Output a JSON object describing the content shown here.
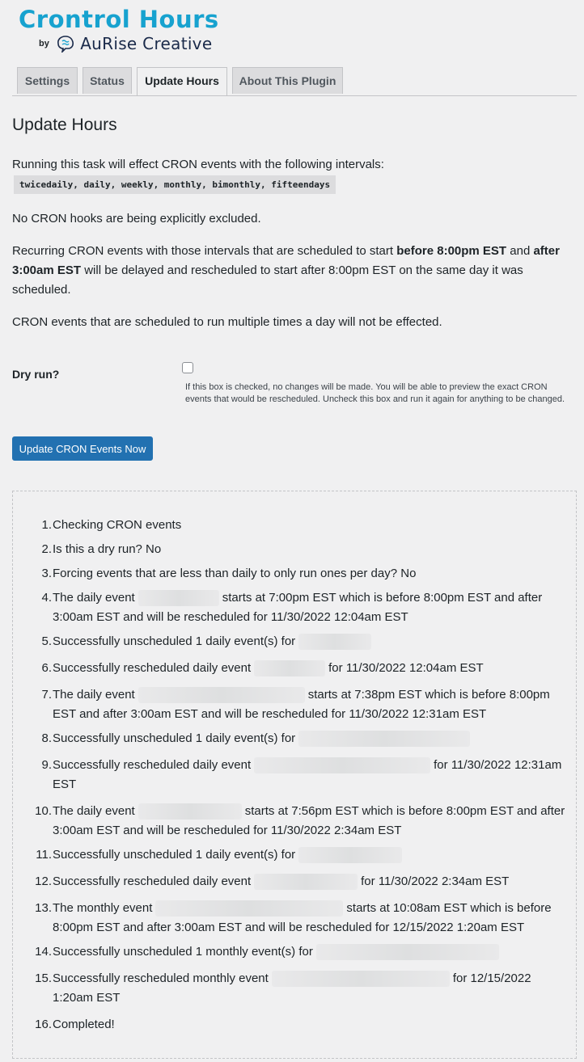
{
  "brand": {
    "title": "Crontrol Hours",
    "by": "by",
    "company": "AuRise Creative",
    "title_color": "#17a2cf"
  },
  "tabs": [
    {
      "label": "Settings",
      "active": false
    },
    {
      "label": "Status",
      "active": false
    },
    {
      "label": "Update Hours",
      "active": true
    },
    {
      "label": "About This Plugin",
      "active": false
    }
  ],
  "page": {
    "heading": "Update Hours",
    "intro": "Running this task will effect CRON events with the following intervals:",
    "intervals": "twicedaily, daily, weekly, monthly, bimonthly, fifteendays",
    "excluded": "No CRON hooks are being explicitly excluded.",
    "schedule": {
      "part1": "Recurring CRON events with those intervals that are scheduled to start ",
      "bold1": "before 8:00pm EST",
      "part2": " and ",
      "bold2": "after 3:00am EST",
      "part3": " will be delayed and rescheduled to start after 8:00pm EST on the same day it was scheduled."
    },
    "multiple": "CRON events that are scheduled to run multiple times a day will not be effected."
  },
  "form": {
    "dry_run_label": "Dry run?",
    "dry_run_checked": false,
    "dry_run_description": "If this box is checked, no changes will be made. You will be able to preview the exact CRON events that would be rescheduled. Uncheck this box and run it again for anything to be changed.",
    "submit_label": "Update CRON Events Now",
    "accent_color": "#2271b1"
  },
  "log": {
    "items": [
      {
        "num": "1.",
        "a": "Checking CRON events"
      },
      {
        "num": "2.",
        "a": "Is this a dry run? No"
      },
      {
        "num": "3.",
        "a": "Forcing events that are less than daily to only run ones per day? No"
      },
      {
        "num": "4.",
        "a": "The daily event",
        "b": "starts at 7:00pm EST which is before 8:00pm EST and after 3:00am EST and will be rescheduled for 11/30/2022 12:04am EST"
      },
      {
        "num": "5.",
        "a": "Successfully unscheduled 1 daily event(s) for"
      },
      {
        "num": "6.",
        "a": "Successfully rescheduled daily event",
        "b": "for 11/30/2022 12:04am EST"
      },
      {
        "num": "7.",
        "a": "The daily event",
        "b": "starts at 7:38pm EST which is before 8:00pm EST and after 3:00am EST and will be rescheduled for 11/30/2022 12:31am EST"
      },
      {
        "num": "8.",
        "a": "Successfully unscheduled 1 daily event(s) for"
      },
      {
        "num": "9.",
        "a": "Successfully rescheduled daily event",
        "b": "for 11/30/2022 12:31am EST"
      },
      {
        "num": "10.",
        "a": "The daily event",
        "b": "starts at 7:56pm EST which is before 8:00pm EST and after 3:00am EST and will be rescheduled for 11/30/2022 2:34am EST"
      },
      {
        "num": "11.",
        "a": "Successfully unscheduled 1 daily event(s) for"
      },
      {
        "num": "12.",
        "a": "Successfully rescheduled daily event",
        "b": "for 11/30/2022 2:34am EST"
      },
      {
        "num": "13.",
        "a": "The monthly event",
        "b": "starts at 10:08am EST which is before 8:00pm EST and after 3:00am EST and will be rescheduled for 12/15/2022 1:20am EST"
      },
      {
        "num": "14.",
        "a": "Successfully unscheduled 1 monthly event(s) for"
      },
      {
        "num": "15.",
        "a": "Successfully rescheduled monthly event",
        "b": "for 12/15/2022 1:20am EST"
      },
      {
        "num": "16.",
        "a": "Completed!"
      }
    ]
  }
}
